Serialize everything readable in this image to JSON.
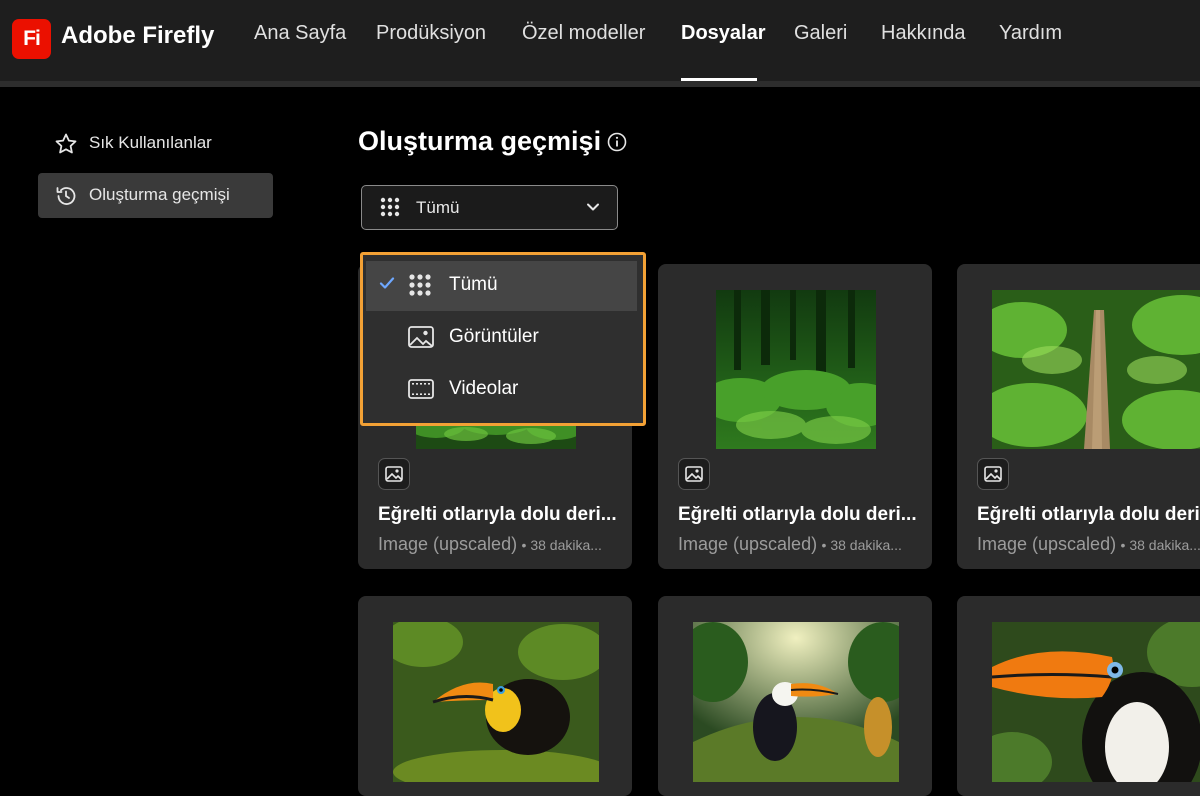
{
  "app": {
    "logo_text": "Fi",
    "brand": "Adobe Firefly",
    "brand_color": "#eb1000"
  },
  "nav": {
    "items": [
      "Ana Sayfa",
      "Prodüksiyon",
      "Özel modeller",
      "Dosyalar",
      "Galeri",
      "Hakkında",
      "Yardım"
    ],
    "active": "Dosyalar"
  },
  "sidebar": {
    "items": [
      {
        "label": "Sık Kullanılanlar",
        "icon": "star-icon",
        "active": false
      },
      {
        "label": "Oluşturma geçmişi",
        "icon": "history-icon",
        "active": true
      }
    ]
  },
  "main": {
    "title": "Oluşturma geçmişi",
    "filter": {
      "value": "Tümü",
      "icon": "grid-icon"
    },
    "menu": {
      "accent_color": "#f3a135",
      "items": [
        {
          "label": "Tümü",
          "icon": "grid-icon",
          "selected": true
        },
        {
          "label": "Görüntüler",
          "icon": "image-icon",
          "selected": false
        },
        {
          "label": "Videolar",
          "icon": "video-icon",
          "selected": false
        }
      ]
    },
    "cards": [
      {
        "title": "Eğrelti otlarıyla dolu deri...",
        "kind": "Image (upscaled)",
        "time": "• 38 dakika...",
        "thumb": "fern-forest"
      },
      {
        "title": "Eğrelti otlarıyla dolu deri...",
        "kind": "Image (upscaled)",
        "time": "• 38 dakika...",
        "thumb": "fern-forest-2"
      },
      {
        "title": "Eğrelti otlarıyla dolu deri...",
        "kind": "Image (upscaled)",
        "time": "• 38 dakika...",
        "thumb": "fern-log"
      },
      {
        "thumb": "toucan-1"
      },
      {
        "thumb": "toucan-2"
      },
      {
        "thumb": "toucan-3"
      }
    ]
  }
}
